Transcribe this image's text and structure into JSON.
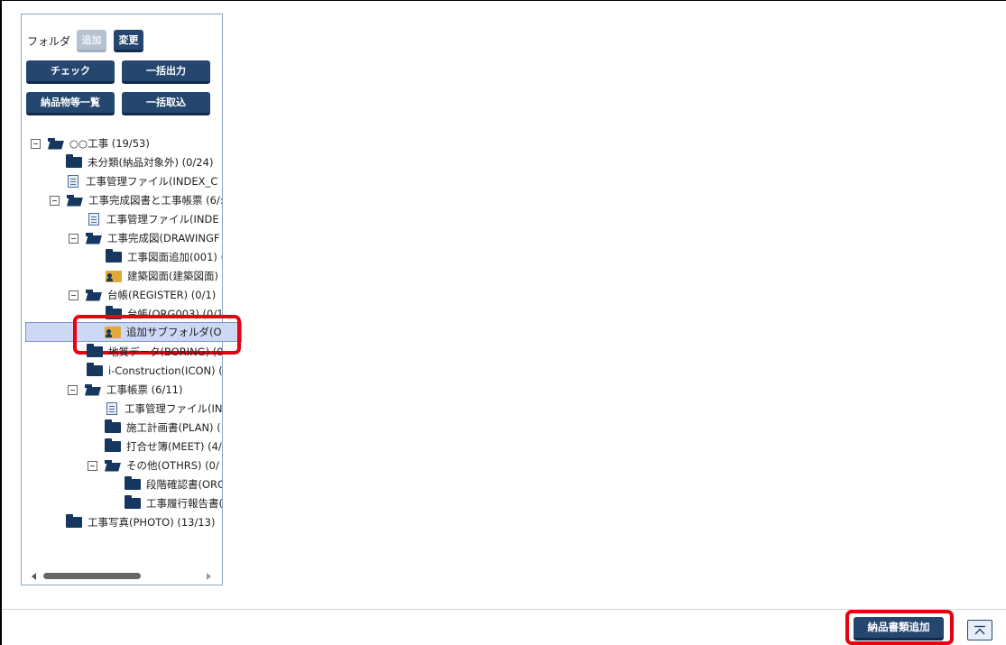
{
  "toolbar": {
    "folder_label": "フォルダ",
    "add_label": "追加",
    "change_label": "変更",
    "check_label": "チェック",
    "bulk_output_label": "一括出力",
    "deliverables_list_label": "納品物等一覧",
    "bulk_import_label": "一括取込"
  },
  "tree": {
    "items": [
      {
        "label": "○○工事 (19/53)",
        "icon": "folder-open-icon"
      },
      {
        "label": "未分類(納品対象外) (0/24)",
        "icon": "folder-icon"
      },
      {
        "label": "工事管理ファイル(INDEX_C",
        "icon": "document-icon"
      },
      {
        "label": "工事完成図書と工事帳票 (6/:",
        "icon": "folder-open-icon"
      },
      {
        "label": "工事管理ファイル(INDE",
        "icon": "document-icon"
      },
      {
        "label": "工事完成図(DRAWINGF",
        "icon": "folder-open-icon"
      },
      {
        "label": "工事図面追加(001) (",
        "icon": "folder-icon"
      },
      {
        "label": "建築図面(建築図面)",
        "icon": "user-folder-icon"
      },
      {
        "label": "台帳(REGISTER) (0/1)",
        "icon": "folder-open-icon"
      },
      {
        "label": "台帳(ORG003) (0/1",
        "icon": "folder-icon"
      },
      {
        "label": "追加サブフォルダ(O",
        "icon": "user-folder-icon"
      },
      {
        "label": "地質データ(BORING) (0",
        "icon": "folder-icon"
      },
      {
        "label": "i-Construction(ICON) (",
        "icon": "folder-icon"
      },
      {
        "label": "工事帳票 (6/11)",
        "icon": "folder-open-icon"
      },
      {
        "label": "工事管理ファイル(IN",
        "icon": "document-icon"
      },
      {
        "label": "施工計画書(PLAN) (",
        "icon": "folder-icon"
      },
      {
        "label": "打合せ簿(MEET) (4/",
        "icon": "folder-icon"
      },
      {
        "label": "その他(OTHRS) (0/",
        "icon": "folder-open-icon"
      },
      {
        "label": "段階確認書(ORG",
        "icon": "folder-icon"
      },
      {
        "label": "工事履行報告書(",
        "icon": "folder-icon"
      },
      {
        "label": "工事写真(PHOTO) (13/13)",
        "icon": "folder-icon"
      }
    ],
    "selected_index": 10
  },
  "footer": {
    "add_documents_label": "納品書類追加",
    "scroll_top_icon": "chevron-up-icon"
  },
  "colors": {
    "primary_button": "#24466f",
    "disabled_button": "#b7c2d1",
    "selection": "#cdd8f5",
    "highlight": "#e60012"
  }
}
